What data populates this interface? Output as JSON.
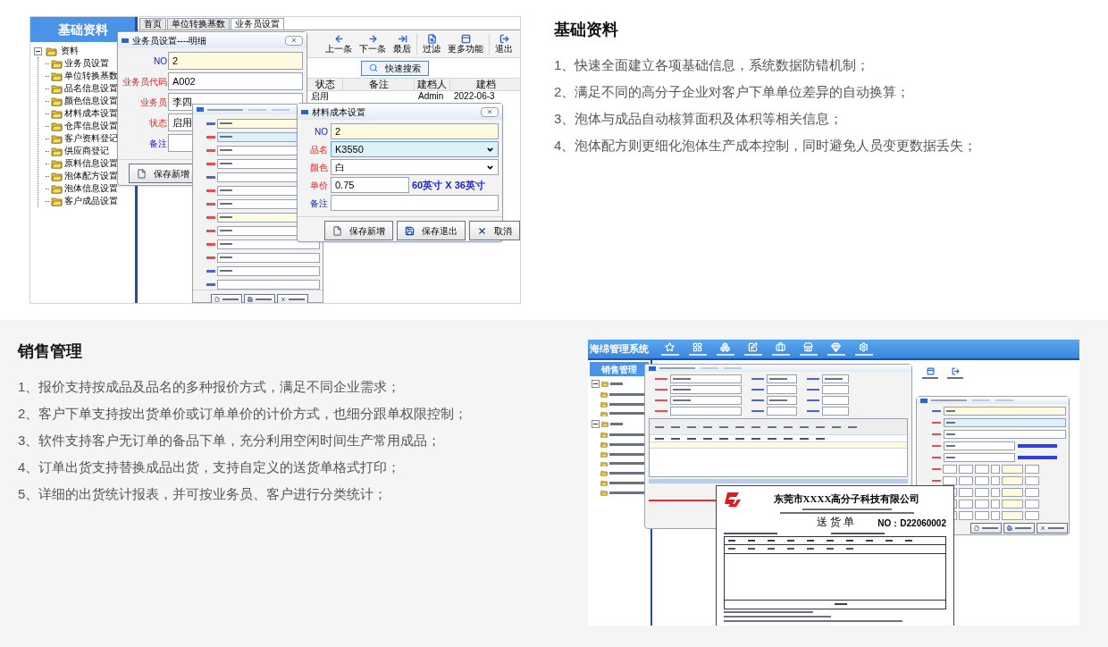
{
  "basic_section": {
    "title": "基础资料",
    "points": [
      "1、快速全面建立各项基础信息，系统数据防错机制；",
      "2、满足不同的高分子企业对客户下单单位差异的自动换算；",
      "3、泡体与成品自动核算面积及体积等相关信息；",
      "4、泡体配方则更细化泡体生产成本控制，同时避免人员变更数据丢失；"
    ]
  },
  "basic_screenshot": {
    "sidebar": {
      "title": "基础资料",
      "tree": [
        {
          "label": "资料",
          "expanded": true,
          "children": [
            {
              "label": "业务员设置"
            },
            {
              "label": "单位转换基数"
            },
            {
              "label": "品名信息设置"
            },
            {
              "label": "颜色信息设置"
            },
            {
              "label": "材料成本设置"
            },
            {
              "label": "仓库信息设置"
            },
            {
              "label": "客户资料登记"
            },
            {
              "label": "供应商登记"
            },
            {
              "label": "原料信息设置"
            },
            {
              "label": "泡体配方设置"
            },
            {
              "label": "泡体信息设置"
            },
            {
              "label": "客户成品设置"
            }
          ]
        }
      ]
    },
    "tabs": [
      {
        "label": "首页",
        "selected": false
      },
      {
        "label": "单位转换基数",
        "selected": false
      },
      {
        "label": "业务员设置",
        "selected": true
      }
    ],
    "toolbar": [
      {
        "label": "上一条"
      },
      {
        "label": "下一条"
      },
      {
        "label": "最后"
      },
      {
        "label": "过滤"
      },
      {
        "label": "更多功能"
      },
      {
        "label": "退出"
      }
    ],
    "search_button": "快速搜索",
    "table": {
      "columns": [
        "状态",
        "备注",
        "建档人",
        "建档"
      ],
      "rows": [
        {
          "cells": [
            "启用",
            null,
            "Admin",
            "2022-06-3"
          ]
        }
      ]
    },
    "salesman_dialog": {
      "title": "业务员设置----明细",
      "fields": [
        {
          "label": "NO",
          "value": "2",
          "kind": "text",
          "required": false,
          "readonly": true,
          "focused": false
        },
        {
          "label": "业务员代码",
          "value": "A002",
          "kind": "text",
          "required": true,
          "readonly": false,
          "focused": false
        },
        {
          "label": "业务员",
          "value": "李四",
          "kind": "text",
          "required": true,
          "readonly": false,
          "focused": false
        },
        {
          "label": "状态",
          "value": "启用",
          "kind": "select",
          "required": true,
          "readonly": false,
          "focused": false
        },
        {
          "label": "备注",
          "kind": "text",
          "required": false,
          "readonly": false,
          "focused": false
        }
      ],
      "buttons": [
        {
          "label": "保存新增"
        }
      ]
    },
    "cost_dialog": {
      "title": "材料成本设置",
      "fields": [
        {
          "label": "NO",
          "value": "2",
          "kind": "text",
          "required": false,
          "readonly": true,
          "focused": false
        },
        {
          "label": "品名",
          "value": "K3550",
          "kind": "select",
          "required": true,
          "readonly": false,
          "focused": true
        },
        {
          "label": "颜色",
          "value": "白",
          "kind": "select",
          "required": true,
          "readonly": false,
          "focused": false
        },
        {
          "label": "单价",
          "value": "0.75",
          "kind": "text",
          "required": true,
          "readonly": false,
          "focused": false,
          "note": "60英寸 X 36英寸"
        },
        {
          "label": "备注",
          "kind": "text",
          "required": false,
          "readonly": false,
          "focused": false
        }
      ],
      "buttons": [
        {
          "label": "保存新增"
        },
        {
          "label": "保存退出"
        },
        {
          "label": "取消"
        }
      ]
    }
  },
  "sales_section": {
    "title": "销售管理",
    "points": [
      "1、报价支持按成品及品名的多种报价方式，满足不同企业需求；",
      "2、客户下单支持按出货单价或订单单价的计价方式，也细分跟单权限控制；",
      "3、软件支持客户无订单的备品下单，充分利用空闲时间生产常用成品；",
      "4、订单出货支持替换成品出货，支持自定义的送货单格式打印；",
      "5、详细的出货统计报表，并可按业务员、客户进行分类统计；"
    ]
  },
  "sales_screenshot": {
    "app_title": "海绵管理系统",
    "sidebar_title": "销售管理",
    "delivery_note": {
      "company": "东莞市XXXX高分子科技有限公司",
      "doc_title": "送 货 单",
      "number": "NO：D22060002"
    }
  }
}
